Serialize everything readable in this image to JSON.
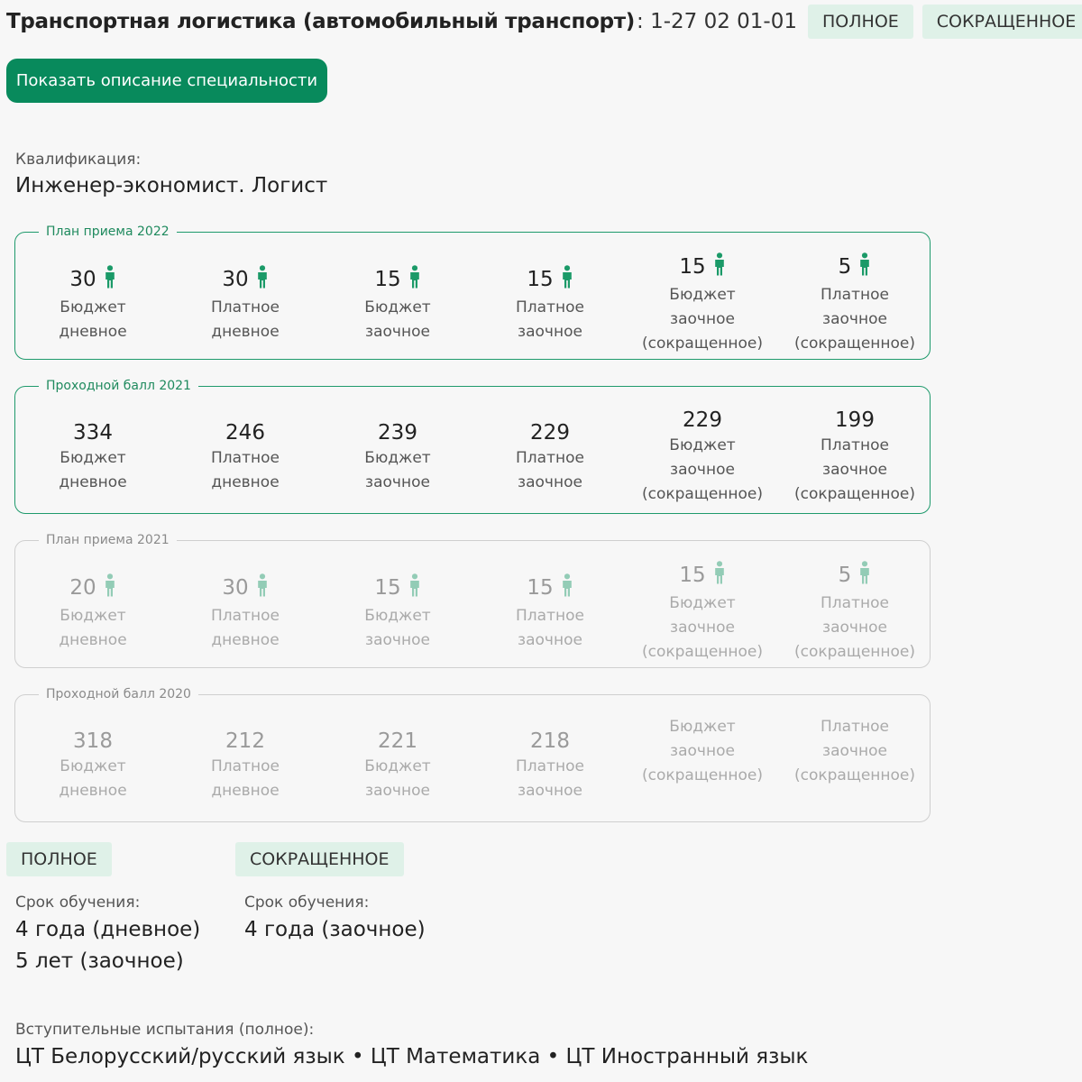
{
  "header": {
    "title": "Транспортная логистика (автомобильный транспорт)",
    "code": ": 1-27 02 01-01",
    "tab_full": "ПОЛНОЕ",
    "tab_short": "СОКРАЩЕННОЕ"
  },
  "show_description_label": "Показать описание специальности",
  "qualification": {
    "label": "Квалификация:",
    "value": "Инженер-экономист. Логист"
  },
  "columns": [
    {
      "l1": "Бюджет",
      "l2": "дневное",
      "l3": ""
    },
    {
      "l1": "Платное",
      "l2": "дневное",
      "l3": ""
    },
    {
      "l1": "Бюджет",
      "l2": "заочное",
      "l3": ""
    },
    {
      "l1": "Платное",
      "l2": "заочное",
      "l3": ""
    },
    {
      "l1": "Бюджет",
      "l2": "заочное",
      "l3": "(сокращенное)"
    },
    {
      "l1": "Платное",
      "l2": "заочное",
      "l3": "(сокращенное)"
    }
  ],
  "plan_2022": {
    "title": "План приема 2022",
    "values": [
      "30",
      "30",
      "15",
      "15",
      "15",
      "5"
    ]
  },
  "score_2021": {
    "title": "Проходной балл 2021",
    "values": [
      "334",
      "246",
      "239",
      "229",
      "229",
      "199"
    ]
  },
  "plan_2021": {
    "title": "План приема 2021",
    "values": [
      "20",
      "30",
      "15",
      "15",
      "15",
      "5"
    ]
  },
  "score_2020": {
    "title": "Проходной балл 2020",
    "values": [
      "318",
      "212",
      "221",
      "218",
      "",
      ""
    ]
  },
  "full": {
    "tag": "ПОЛНОЕ",
    "duration_label": "Срок обучения:",
    "duration_1": "4 года (дневное)",
    "duration_2": "5 лет (заочное)"
  },
  "short": {
    "tag": "СОКРАЩЕННОЕ",
    "duration_label": "Срок обучения:",
    "duration_1": "4 года (заочное)"
  },
  "exams": {
    "label": "Вступительные испытания (полное):",
    "value": "ЦТ Белорусский/русский язык • ЦТ Математика • ЦТ Иностранный язык"
  },
  "colors": {
    "accent": "#088a5c",
    "border_active": "#1f9a6c",
    "border_muted": "#cfcfcf",
    "tag_bg": "#dff1e8",
    "person_icon": "#1b9a68"
  },
  "icons": {
    "seat": "person-icon"
  }
}
